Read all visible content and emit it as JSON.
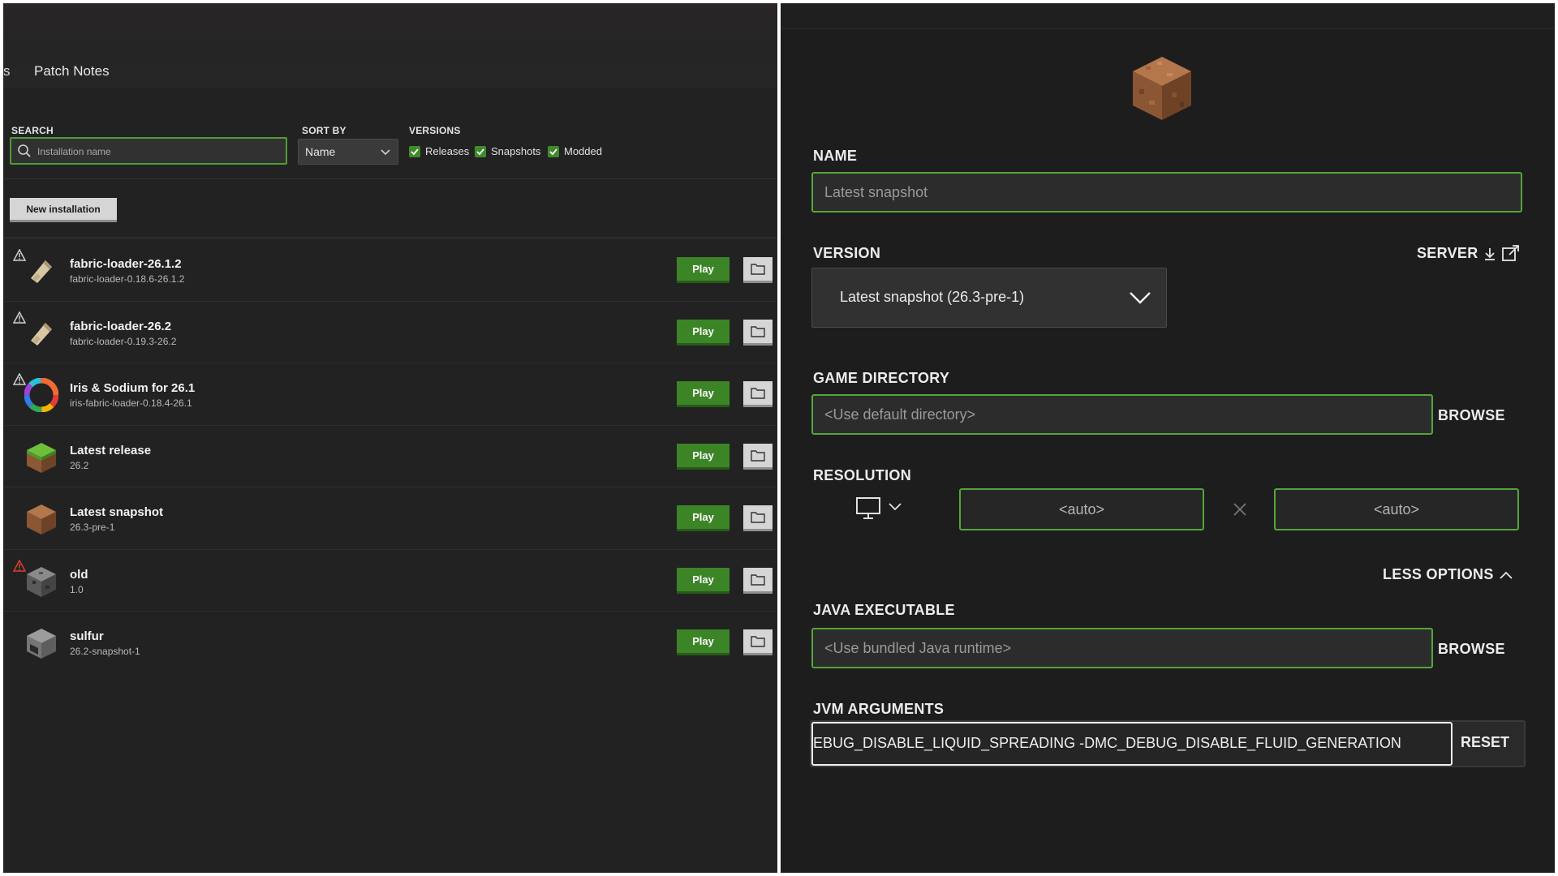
{
  "left": {
    "tab_stub": "s",
    "tab_patch_notes": "Patch Notes",
    "search": {
      "label": "SEARCH",
      "placeholder": "Installation name"
    },
    "sort": {
      "label": "SORT BY",
      "value": "Name"
    },
    "versions": {
      "label": "VERSIONS",
      "releases": "Releases",
      "snapshots": "Snapshots",
      "modded": "Modded"
    },
    "new_installation": "New installation",
    "play_label": "Play",
    "installations": [
      {
        "name": "fabric-loader-26.1.2",
        "version": "fabric-loader-0.18.6-26.1.2",
        "icon": "fabric-icon",
        "warning": "gray"
      },
      {
        "name": "fabric-loader-26.2",
        "version": "fabric-loader-0.19.3-26.2",
        "icon": "fabric-icon",
        "warning": "gray"
      },
      {
        "name": "Iris & Sodium for 26.1",
        "version": "iris-fabric-loader-0.18.4-26.1",
        "icon": "iris-icon",
        "warning": "gray"
      },
      {
        "name": "Latest release",
        "version": "26.2",
        "icon": "grass-block-icon",
        "warning": "none"
      },
      {
        "name": "Latest snapshot",
        "version": "26.3-pre-1",
        "icon": "dirt-block-icon",
        "warning": "none"
      },
      {
        "name": "old",
        "version": "1.0",
        "icon": "bedrock-block-icon",
        "warning": "red"
      },
      {
        "name": "sulfur",
        "version": "26.2-snapshot-1",
        "icon": "furnace-block-icon",
        "warning": "none"
      }
    ]
  },
  "right": {
    "name": {
      "label": "NAME",
      "value": "Latest snapshot"
    },
    "version": {
      "label": "VERSION",
      "value": "Latest snapshot (26.3-pre-1)",
      "server_link": "SERVER"
    },
    "game_directory": {
      "label": "GAME DIRECTORY",
      "value": "<Use default directory>",
      "browse": "BROWSE"
    },
    "resolution": {
      "label": "RESOLUTION",
      "width": "<auto>",
      "height": "<auto>"
    },
    "less_options": "LESS OPTIONS",
    "java_executable": {
      "label": "JAVA EXECUTABLE",
      "value": "<Use bundled Java runtime>",
      "browse": "BROWSE"
    },
    "jvm_arguments": {
      "label": "JVM ARGUMENTS",
      "value": "EBUG_DISABLE_LIQUID_SPREADING -DMC_DEBUG_DISABLE_FLUID_GENERATION",
      "reset": "RESET"
    }
  },
  "colors": {
    "accent_green": "#3c8527",
    "focus_green": "#55a53a",
    "warning_red": "#d9412f"
  }
}
